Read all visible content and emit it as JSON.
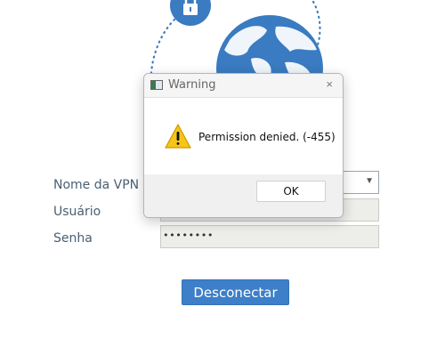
{
  "form": {
    "vpn_name_label": "Nome da VPN",
    "user_label": "Usuário",
    "password_label": "Senha",
    "password_value": "••••••••",
    "disconnect_label": "Desconectar"
  },
  "dialog": {
    "title": "Warning",
    "message": "Permission denied. (-455)",
    "ok_label": "OK",
    "close_glyph": "×"
  },
  "icons": {
    "lock": "lock-icon",
    "globe": "globe-icon",
    "warning": "warning-icon",
    "select_arrow": "▼"
  },
  "colors": {
    "accent": "#3d7fc8",
    "globe": "#3a7bc1",
    "warning": "#f5c518"
  }
}
